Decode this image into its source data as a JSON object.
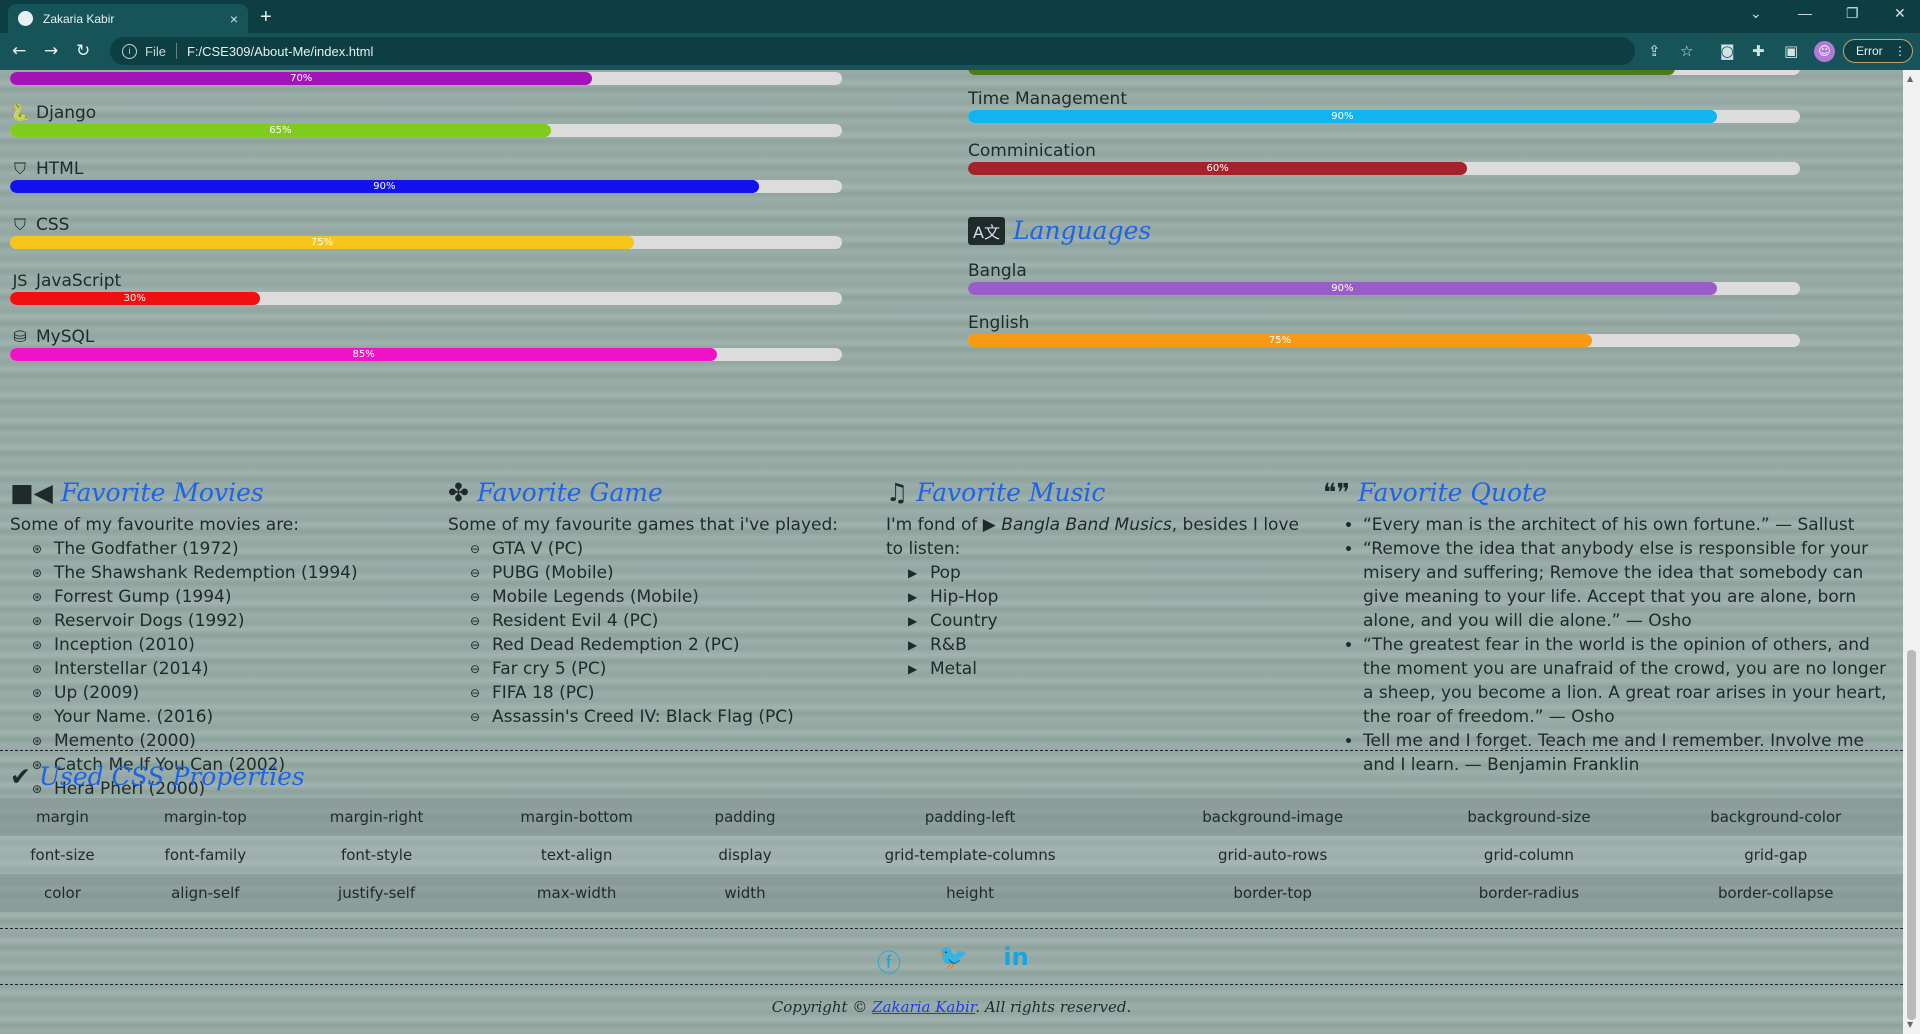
{
  "browser": {
    "tab_title": "Zakaria Kabir",
    "url_scheme": "File",
    "url": "F:/CSE309/About-Me/index.html",
    "error_label": "Error",
    "new_tab_symbol": "+",
    "close_symbol": "×"
  },
  "tech_skills": [
    {
      "name": "",
      "percent": 70,
      "label": "70%",
      "color": "#a313b7"
    },
    {
      "name": "Django",
      "percent": 65,
      "label": "65%",
      "color": "#7fcc1c",
      "icon": "python-icon"
    },
    {
      "name": "HTML",
      "percent": 90,
      "label": "90%",
      "color": "#1212ee",
      "icon": "html5-icon"
    },
    {
      "name": "CSS",
      "percent": 75,
      "label": "75%",
      "color": "#f5c518",
      "icon": "css3-icon"
    },
    {
      "name": "JavaScript",
      "percent": 30,
      "label": "30%",
      "color": "#f01010",
      "icon": "js-icon"
    },
    {
      "name": "MySQL",
      "percent": 85,
      "label": "85%",
      "color": "#f012c6",
      "icon": "database-icon"
    }
  ],
  "soft_skills": [
    {
      "name": "Time Management",
      "percent": 90,
      "label": "90%",
      "color": "#12b4f0"
    },
    {
      "name": "Comminication",
      "percent": 60,
      "label": "60%",
      "color": "#a3222c"
    }
  ],
  "languages": {
    "title": "Languages",
    "items": [
      {
        "name": "Bangla",
        "percent": 90,
        "label": "90%",
        "color": "#9a5cc6"
      },
      {
        "name": "English",
        "percent": 75,
        "label": "75%",
        "color": "#f59a12"
      }
    ]
  },
  "movies": {
    "title": "Favorite Movies",
    "intro": "Some of my favourite movies are:",
    "items": [
      "The Godfather (1972)",
      "The Shawshank Redemption (1994)",
      "Forrest Gump (1994)",
      "Reservoir Dogs (1992)",
      "Inception (2010)",
      "Interstellar (2014)",
      "Up (2009)",
      "Your Name. (2016)",
      "Memento (2000)",
      "Catch Me If You Can (2002)",
      "Hera Pheri (2000)"
    ]
  },
  "games": {
    "title": "Favorite Game",
    "intro": "Some of my favourite games that i've played:",
    "items": [
      "GTA V (PC)",
      "PUBG (Mobile)",
      "Mobile Legends (Mobile)",
      "Resident Evil 4 (PC)",
      "Red Dead Redemption 2 (PC)",
      "Far cry 5 (PC)",
      "FIFA 18 (PC)",
      "Assassin's Creed IV: Black Flag (PC)"
    ]
  },
  "music": {
    "title": "Favorite Music",
    "intro_a": "I'm fond of ",
    "intro_em": "Bangla Band Musics",
    "intro_b": ", besides I love to listen:",
    "items": [
      "Pop",
      "Hip-Hop",
      "Country",
      "R&B",
      "Metal"
    ]
  },
  "quotes": {
    "title": "Favorite Quote",
    "items": [
      "“Every man is the architect of his own fortune.” — Sallust",
      "“Remove the idea that anybody else is responsible for your misery and suffering; Remove the idea that somebody can give meaning to your life. Accept that you are alone, born alone, and you will die alone.” — Osho",
      "“The greatest fear in the world is the opinion of others, and the moment you are unafraid of the crowd, you are no longer a sheep, you become a lion. A great roar arises in your heart, the roar of freedom.” — Osho",
      "Tell me and I forget. Teach me and I remember. Involve me and I learn. — Benjamin Franklin"
    ]
  },
  "css_props": {
    "title": "Used CSS Properties",
    "rows": [
      [
        "margin",
        "margin-top",
        "margin-right",
        "margin-bottom",
        "padding",
        "padding-left",
        "background-image",
        "background-size",
        "background-color"
      ],
      [
        "font-size",
        "font-family",
        "font-style",
        "text-align",
        "display",
        "grid-template-columns",
        "grid-auto-rows",
        "grid-column",
        "grid-gap"
      ],
      [
        "color",
        "align-self",
        "justify-self",
        "max-width",
        "width",
        "height",
        "border-top",
        "border-radius",
        "border-collapse"
      ]
    ]
  },
  "social": [
    "facebook-icon",
    "twitter-icon",
    "linkedin-icon"
  ],
  "footer": {
    "prefix": "Copyright © ",
    "name": "Zakaria Kabir",
    "suffix": ". All rights reserved."
  }
}
